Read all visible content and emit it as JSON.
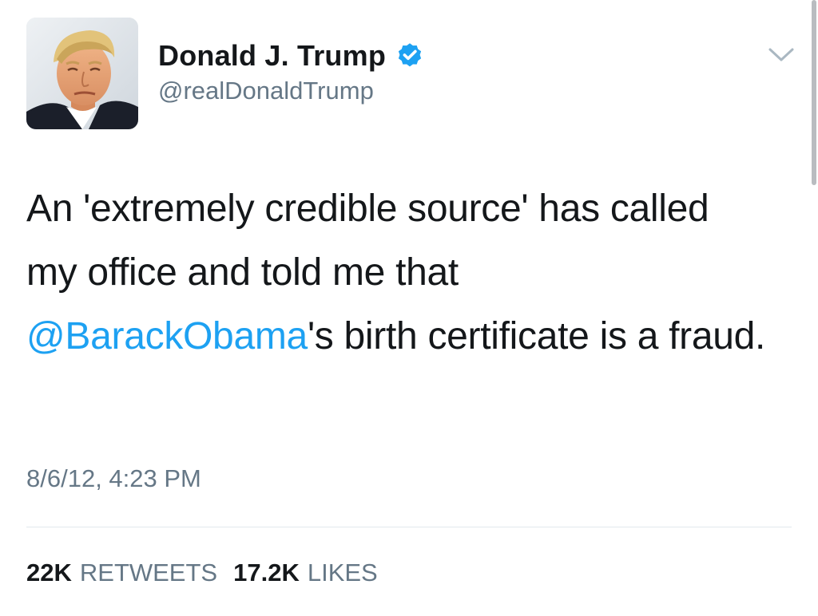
{
  "author": {
    "display_name": "Donald J. Trump",
    "handle": "@realDonaldTrump",
    "verified": true,
    "avatar_icon": "profile-photo"
  },
  "tweet": {
    "text_part1": "An 'extremely credible source' has called my office and told me that ",
    "mention": "@BarackObama",
    "text_part2": "'s birth certificate is a fraud.",
    "timestamp": "8/6/12, 4:23 PM"
  },
  "stats": {
    "retweets_count": "22K",
    "retweets_label": "RETWEETS",
    "likes_count": "17.2K",
    "likes_label": "LIKES"
  },
  "colors": {
    "mention": "#1da1f2",
    "verified_badge": "#1da1f2",
    "secondary_text": "#657786",
    "primary_text": "#14171a"
  },
  "icons": {
    "verified": "verified-badge-icon",
    "menu": "chevron-down-icon"
  }
}
